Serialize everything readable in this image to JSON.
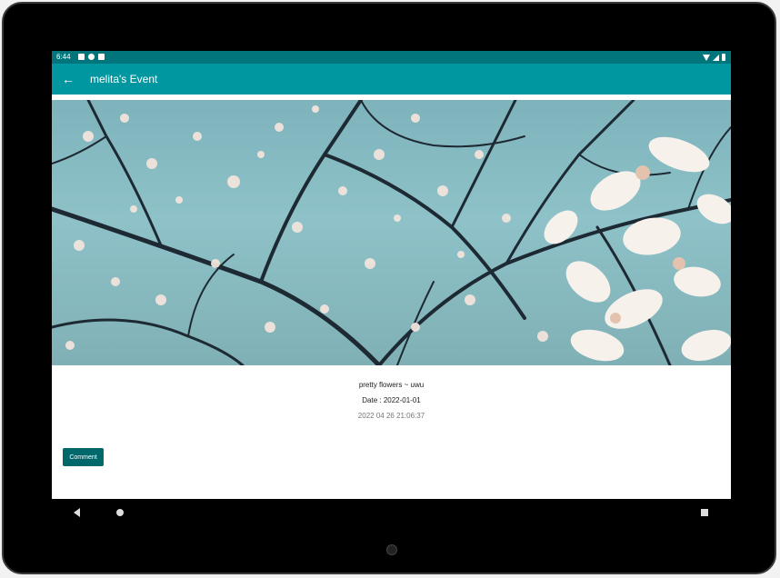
{
  "status_bar": {
    "time": "6:44",
    "left_icons": [
      "notification-icon",
      "sync-icon",
      "sd-card-icon"
    ],
    "right_icons": [
      "wifi-icon",
      "signal-icon",
      "battery-icon"
    ]
  },
  "app_bar": {
    "title": "melita's Event",
    "back_icon": "arrow-left-icon",
    "color": "#0097a0"
  },
  "event": {
    "image_alt": "cherry blossom branches",
    "title": "pretty flowers ~ uwu",
    "date": "Date : 2022-01-01",
    "timestamp": "2022 04 26 21:06:37"
  },
  "actions": {
    "comment_label": "Comment"
  },
  "nav": {
    "back_icon": "nav-back-icon",
    "home_icon": "nav-home-icon",
    "recents_icon": "nav-recents-icon"
  }
}
